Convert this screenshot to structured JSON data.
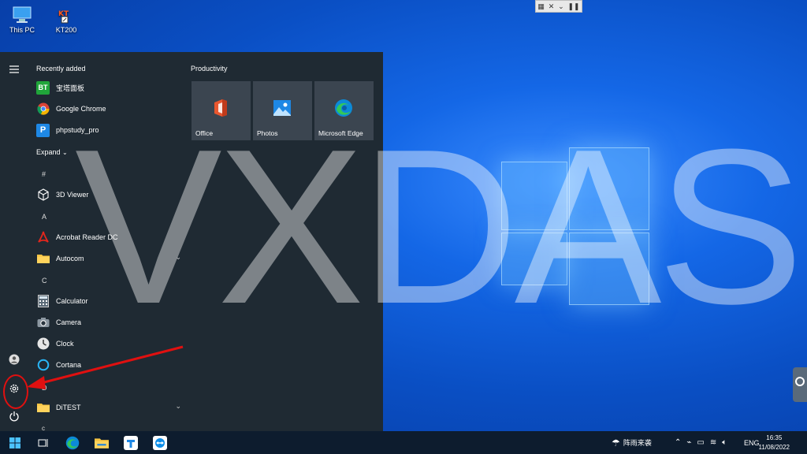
{
  "desktop": {
    "icons": [
      {
        "label": "This PC",
        "icon": "computer-icon"
      },
      {
        "label": "KT200",
        "icon": "kt200-app-icon"
      }
    ],
    "remote_toolbar": {
      "icons": [
        "grid-icon",
        "close-icon",
        "chevron-down-icon",
        "pause-icon"
      ],
      "glyphs": [
        "▦",
        "✕",
        "⌄",
        "❚❚"
      ]
    },
    "watermark": "VXDAS"
  },
  "start_menu": {
    "recently_added_header": "Recently added",
    "recent": [
      {
        "label": "宝塔面板",
        "icon_text": "BT",
        "color": "#20a53a"
      },
      {
        "label": "Google Chrome",
        "icon_text": "",
        "color": "#ffffff"
      },
      {
        "label": "phpstudy_pro",
        "icon_text": "P",
        "color": "#1e88e5"
      }
    ],
    "expand_label": "Expand",
    "sections": [
      {
        "letter": "#",
        "apps": [
          {
            "label": "3D Viewer",
            "icon": "cube-icon"
          }
        ]
      },
      {
        "letter": "A",
        "apps": [
          {
            "label": "Acrobat Reader DC",
            "icon": "acrobat-icon"
          },
          {
            "label": "Autocom",
            "icon": "folder-icon",
            "expandable": true
          }
        ]
      },
      {
        "letter": "C",
        "apps": [
          {
            "label": "Calculator",
            "icon": "calculator-icon"
          },
          {
            "label": "Camera",
            "icon": "camera-icon"
          },
          {
            "label": "Clock",
            "icon": "clock-icon"
          },
          {
            "label": "Cortana",
            "icon": "cortana-icon"
          }
        ]
      },
      {
        "letter": "D",
        "apps": [
          {
            "label": "DiTEST",
            "icon": "folder-icon",
            "expandable": true
          }
        ]
      },
      {
        "letter": "c",
        "apps": []
      }
    ],
    "group_title": "Productivity",
    "tiles": [
      {
        "label": "Office",
        "icon": "office-icon"
      },
      {
        "label": "Photos",
        "icon": "photos-icon"
      },
      {
        "label": "Microsoft Edge",
        "icon": "edge-icon"
      }
    ]
  },
  "taskbar": {
    "apps": [
      "start-icon",
      "task-view-icon",
      "edge-icon",
      "file-explorer-icon",
      "tencent-meeting-icon",
      "teamviewer-icon"
    ],
    "weather": "阵雨来袭",
    "language": "ENG",
    "time": "16:35",
    "date": "11/08/2022"
  },
  "colors": {
    "accent": "#0078d7",
    "menu_bg": "#1f2a33",
    "annotation": "#e01010"
  }
}
